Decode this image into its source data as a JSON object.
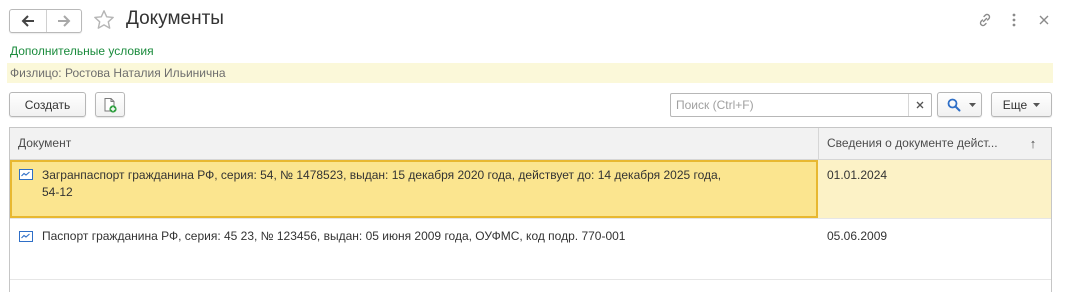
{
  "window": {
    "title": "Документы"
  },
  "conditions": {
    "link_label": "Дополнительные условия",
    "filter_text": "Физлицо: Ростова Наталия Ильинична"
  },
  "toolbar": {
    "create_label": "Создать",
    "search_placeholder": "Поиск (Ctrl+F)",
    "search_value": "",
    "more_label": "Еще"
  },
  "table": {
    "columns": [
      {
        "label": "Документ"
      },
      {
        "label": "Сведения о документе дейст...",
        "sort": "↑"
      }
    ],
    "rows": [
      {
        "document_line1": "Загранпаспорт гражданина РФ, серия: 54, № 1478523, выдан: 15 декабря 2020 года, действует до: 14 декабря 2025 года,",
        "document_line2": "54-12",
        "date": "01.01.2024",
        "selected": true
      },
      {
        "document_line1": "Паспорт гражданина РФ, серия: 45 23, № 123456, выдан: 05 июня 2009 года, ОУФМС, код подр. 770-001",
        "date": "05.06.2009",
        "selected": false
      }
    ]
  },
  "colors": {
    "accent_green": "#1a8b3c",
    "selection_fill": "#fbe58f",
    "selection_border": "#e8b830",
    "filter_bg": "#fbf8d9",
    "icon_blue": "#2f6fc7"
  },
  "icons": [
    "back-arrow-icon",
    "forward-arrow-icon",
    "favorite-star-icon",
    "link-icon",
    "more-vertical-icon",
    "close-icon",
    "add-copy-icon",
    "clear-x-icon",
    "search-icon",
    "chevron-down-icon",
    "document-row-icon",
    "sort-up-icon"
  ]
}
